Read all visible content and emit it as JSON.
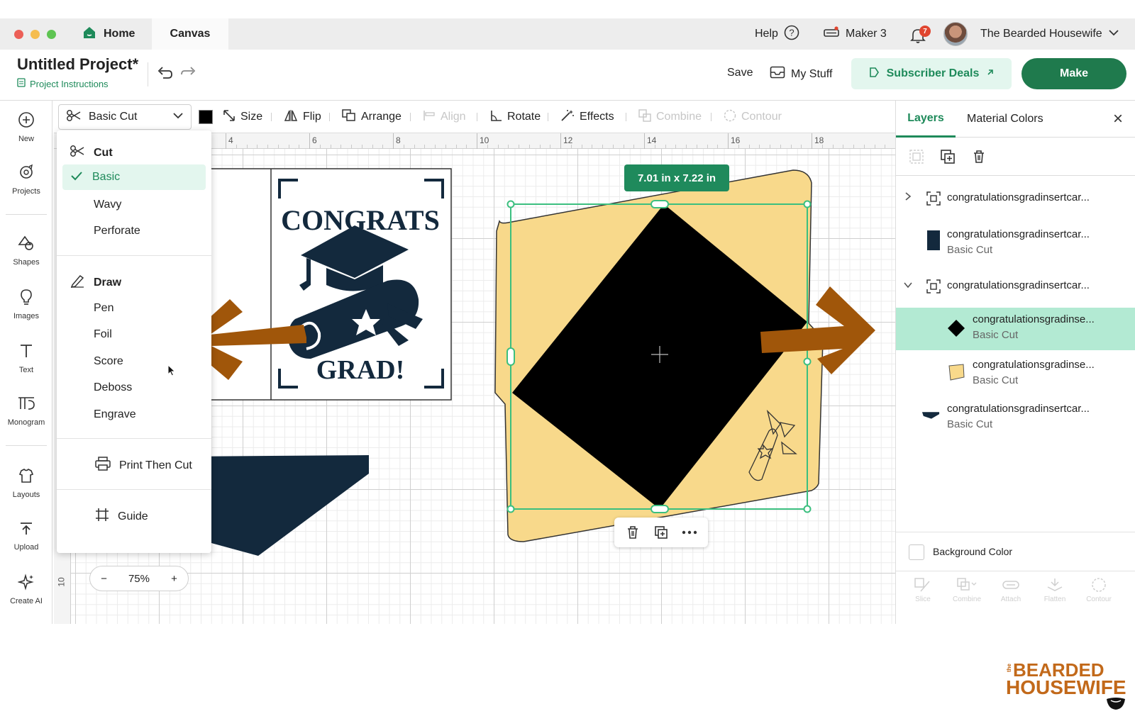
{
  "window": {
    "tabs": [
      {
        "label": "Home"
      },
      {
        "label": "Canvas"
      }
    ],
    "help_label": "Help",
    "machine_label": "Maker 3",
    "notification_count": "7",
    "user_name": "The Bearded Housewife"
  },
  "project": {
    "title": "Untitled Project*",
    "instructions_label": "Project Instructions",
    "save_label": "Save",
    "my_stuff_label": "My Stuff",
    "subscriber_deals_label": "Subscriber Deals",
    "make_label": "Make"
  },
  "sidebar": {
    "items": [
      {
        "label": "New",
        "icon": "plus-circle-icon"
      },
      {
        "label": "Projects",
        "icon": "projects-icon"
      },
      {
        "label": "Shapes",
        "icon": "shapes-icon"
      },
      {
        "label": "Images",
        "icon": "lightbulb-icon"
      },
      {
        "label": "Text",
        "icon": "text-icon"
      },
      {
        "label": "Monogram",
        "icon": "monogram-icon"
      },
      {
        "label": "Layouts",
        "icon": "layouts-icon"
      },
      {
        "label": "Upload",
        "icon": "upload-icon"
      },
      {
        "label": "Create AI",
        "icon": "sparkle-icon"
      }
    ]
  },
  "toolbar": {
    "operation_value": "Basic Cut",
    "color": "#000000",
    "tools": {
      "size": "Size",
      "flip": "Flip",
      "arrange": "Arrange",
      "align": "Align",
      "rotate": "Rotate",
      "effects": "Effects",
      "combine": "Combine",
      "contour": "Contour"
    }
  },
  "operation_menu": {
    "cut_heading": "Cut",
    "cut_items": [
      "Basic",
      "Wavy",
      "Perforate"
    ],
    "selected_item": "Basic",
    "draw_heading": "Draw",
    "draw_items": [
      "Pen",
      "Foil",
      "Score",
      "Deboss",
      "Engrave"
    ],
    "print_then_cut": "Print Then Cut",
    "guide": "Guide"
  },
  "canvas": {
    "ruler_labels": [
      "4",
      "6",
      "8",
      "10",
      "12",
      "14",
      "16",
      "18"
    ],
    "left_ruler_label": "10",
    "size_badge": "7.01  in x 7.22  in",
    "zoom_level": "75%",
    "zoom_minus": "−",
    "zoom_plus": "+",
    "card_text_top": "CONGRATS",
    "card_text_bottom": "GRAD!",
    "colors": {
      "navy": "#13293d",
      "black": "#000000",
      "yellow": "#f8d98b",
      "selection": "#3bbf7f",
      "arrow": "#a0560a"
    }
  },
  "layers_panel": {
    "tabs": [
      {
        "label": "Layers"
      },
      {
        "label": "Material Colors"
      }
    ],
    "layers": [
      {
        "name": "congratulationsgradinsertcar...",
        "operation": "",
        "kind": "group",
        "expanded": false
      },
      {
        "name": "congratulationsgradinsertcar...",
        "operation": "Basic Cut",
        "kind": "navy-rect"
      },
      {
        "name": "congratulationsgradinsertcar...",
        "operation": "",
        "kind": "group",
        "expanded": true
      },
      {
        "name": "congratulationsgradinse...",
        "operation": "Basic Cut",
        "kind": "black-diamond",
        "selected": true
      },
      {
        "name": "congratulationsgradinse...",
        "operation": "Basic Cut",
        "kind": "yellow-shape"
      },
      {
        "name": "congratulationsgradinsertcar...",
        "operation": "Basic Cut",
        "kind": "navy-triangle"
      }
    ],
    "background_color_label": "Background Color",
    "bottom_tools": [
      "Slice",
      "Combine",
      "Attach",
      "Flatten",
      "Contour"
    ]
  },
  "branding": {
    "the": "the",
    "line1": "BEARDED",
    "line2": "HOUSEWIFE"
  }
}
